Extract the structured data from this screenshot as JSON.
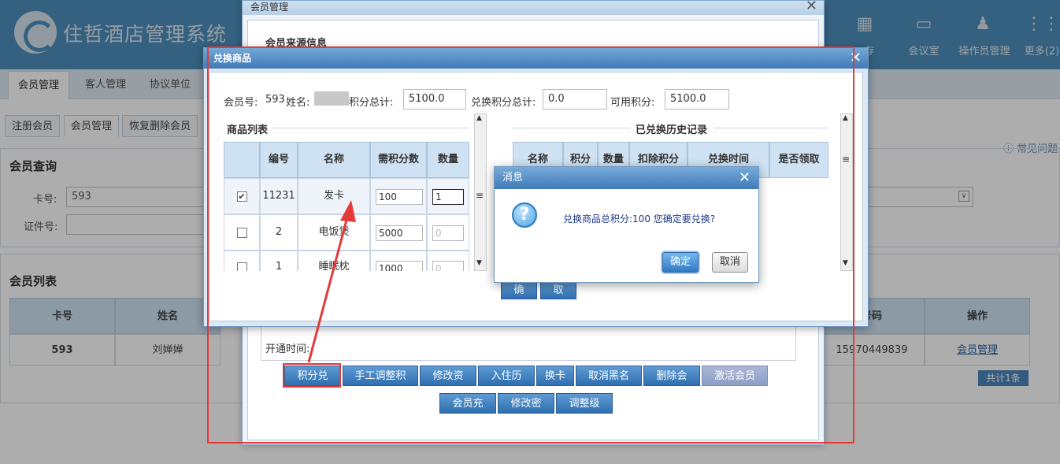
{
  "app": {
    "title": "住哲酒店管理系统"
  },
  "header": {
    "icons": [
      {
        "icon": "storage-icon",
        "label": "存"
      },
      {
        "icon": "meeting-room-icon",
        "label": "会议室"
      },
      {
        "icon": "operator-icon",
        "label": "操作员管理"
      },
      {
        "icon": "more-icon",
        "label": "更多(2)"
      }
    ]
  },
  "main_tabs": [
    "会员管理",
    "客人管理",
    "协议单位"
  ],
  "sub_tabs": [
    "注册会员",
    "会员管理",
    "恢复删除会员"
  ],
  "help_link": "常见问题",
  "query": {
    "title": "会员查询",
    "card_label": "卡号:",
    "card_value": "593",
    "id_label": "证件号:"
  },
  "member_list": {
    "title": "会员列表",
    "columns": [
      "卡号",
      "姓名",
      "号码",
      "操作"
    ],
    "rows": [
      {
        "card": "593",
        "name": "刘婵婵",
        "phone": "15970449839",
        "action": "会员管理"
      }
    ],
    "total": "共计1条"
  },
  "member_dialog": {
    "title": "会员管理",
    "section": "会员来源信息",
    "hidden_text": "会员来源信息·会员来源",
    "open_time_label": "开通时间:",
    "buttons_row1": [
      "积分兑换",
      "手工调整积分",
      "修改资料",
      "入住历史",
      "换卡",
      "取消黑名单",
      "删除会员",
      "激活会员卡"
    ],
    "buttons_row2": [
      "会员充值",
      "修改密码",
      "调整级别"
    ]
  },
  "exchange_dialog": {
    "title": "兑换商品",
    "member_no_label": "会员号:",
    "member_no": "593",
    "name_label": "姓名:",
    "total_points_label": "积分总计:",
    "total_points": "5100.0",
    "exchange_total_label": "兑换积分总计:",
    "exchange_total": "0.0",
    "available_label": "可用积分:",
    "available": "5100.0",
    "goods_title": "商品列表",
    "goods_columns": [
      "编号",
      "名称",
      "需积分数",
      "数量"
    ],
    "goods": [
      {
        "checked": true,
        "id": "11231",
        "name": "发卡",
        "points": "100",
        "qty": "1"
      },
      {
        "checked": false,
        "id": "2",
        "name": "电饭煲",
        "points": "5000",
        "qty": "0"
      },
      {
        "checked": false,
        "id": "1",
        "name": "睡眠枕",
        "points": "1000",
        "qty": "0"
      }
    ],
    "history_title": "已兑换历史记录",
    "history_columns": [
      "名称",
      "积分",
      "数量",
      "扣除积分",
      "兑换时间",
      "是否领取"
    ],
    "ok": "确定",
    "cancel": "取消"
  },
  "message": {
    "title": "消息",
    "text_prefix": "兑换商品总积分:",
    "points": "100",
    "text_suffix": "您确定要兑换?",
    "ok": "确定",
    "cancel": "取消"
  },
  "colors": {
    "header": "#4d90bd",
    "accent": "#2f6fb0",
    "annotation": "#e53a3a"
  }
}
